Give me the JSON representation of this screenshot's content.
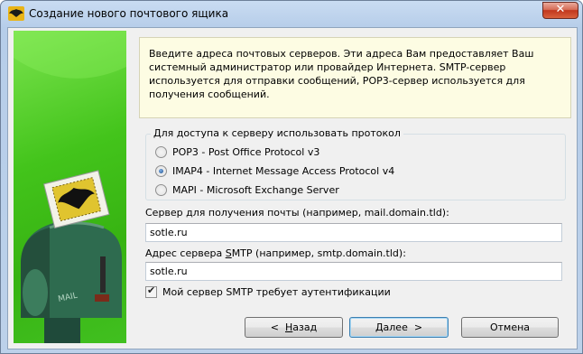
{
  "window": {
    "title": "Создание нового почтового ящика",
    "close_glyph": "✕"
  },
  "info_text": "Введите адреса почтовых серверов. Эти адреса Вам предоставляет Ваш системный администратор или провайдер Интернета. SMTP-сервер используется для отправки сообщений, POP3-сервер используется для получения сообщений.",
  "protocol_group": {
    "label": "Для доступа к серверу использовать протокол",
    "options": [
      {
        "label": "POP3 - Post Office Protocol v3",
        "selected": false
      },
      {
        "label": "IMAP4 - Internet Message Access Protocol v4",
        "selected": true
      },
      {
        "label": "MAPI - Microsoft Exchange Server",
        "selected": false
      }
    ]
  },
  "incoming": {
    "label": "Сервер для получения почты  (например, mail.domain.tld):",
    "value": "sotle.ru"
  },
  "smtp": {
    "label_pre": "Адрес сервера ",
    "label_key": "S",
    "label_post": "MTP (например, smtp.domain.tld):",
    "value": "sotle.ru"
  },
  "smtp_auth": {
    "label": "Мой сервер SMTP требует аутентификации",
    "checked": true
  },
  "buttons": {
    "back": {
      "arrow": "<",
      "key": "Н",
      "rest": "азад"
    },
    "next": {
      "key": "Д",
      "rest": "алее",
      "arrow": ">"
    },
    "cancel": {
      "label": "Отмена"
    }
  },
  "side_art": {
    "box_text": "MAIL"
  },
  "colors": {
    "side_green": "#43c41b",
    "info_bg": "#fdfce3",
    "titlebar": "#c9dcf2",
    "close": "#c1361d"
  }
}
